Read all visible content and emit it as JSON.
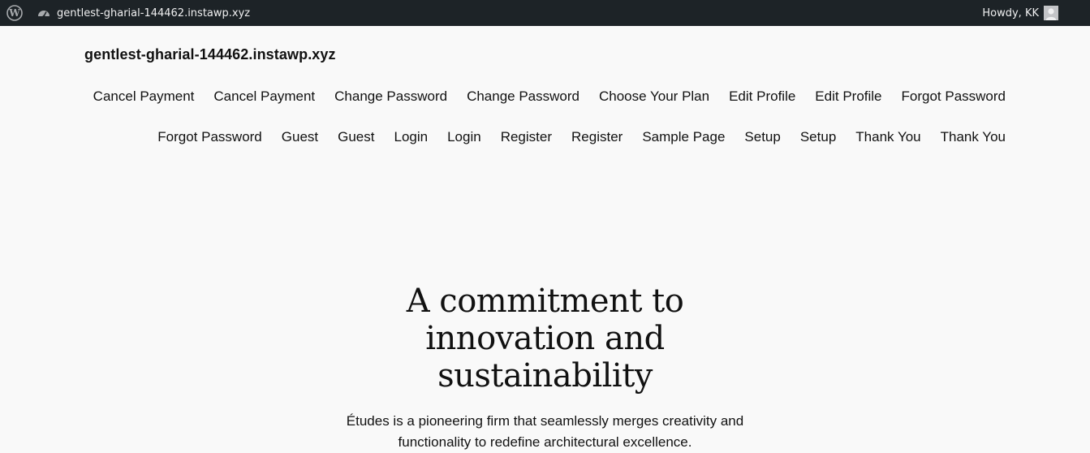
{
  "admin_bar": {
    "wp_logo_icon": "wordpress-icon",
    "dashboard_icon": "dashboard-icon",
    "site_name": "gentlest-gharial-144462.instawp.xyz",
    "howdy": "Howdy, KK",
    "background": "#1d2327"
  },
  "header": {
    "site_title": "gentlest-gharial-144462.instawp.xyz"
  },
  "nav": {
    "items": [
      "Cancel Payment",
      "Cancel Payment",
      "Change Password",
      "Change Password",
      "Choose Your Plan",
      "Edit Profile",
      "Edit Profile",
      "Forgot Password",
      "Forgot Password",
      "Guest",
      "Guest",
      "Login",
      "Login",
      "Register",
      "Register",
      "Sample Page",
      "Setup",
      "Setup",
      "Thank You",
      "Thank You"
    ]
  },
  "hero": {
    "title": "A commitment to innovation and sustainability",
    "text": "Études is a pioneering firm that seamlessly merges creativity and functionality to redefine architectural excellence."
  }
}
